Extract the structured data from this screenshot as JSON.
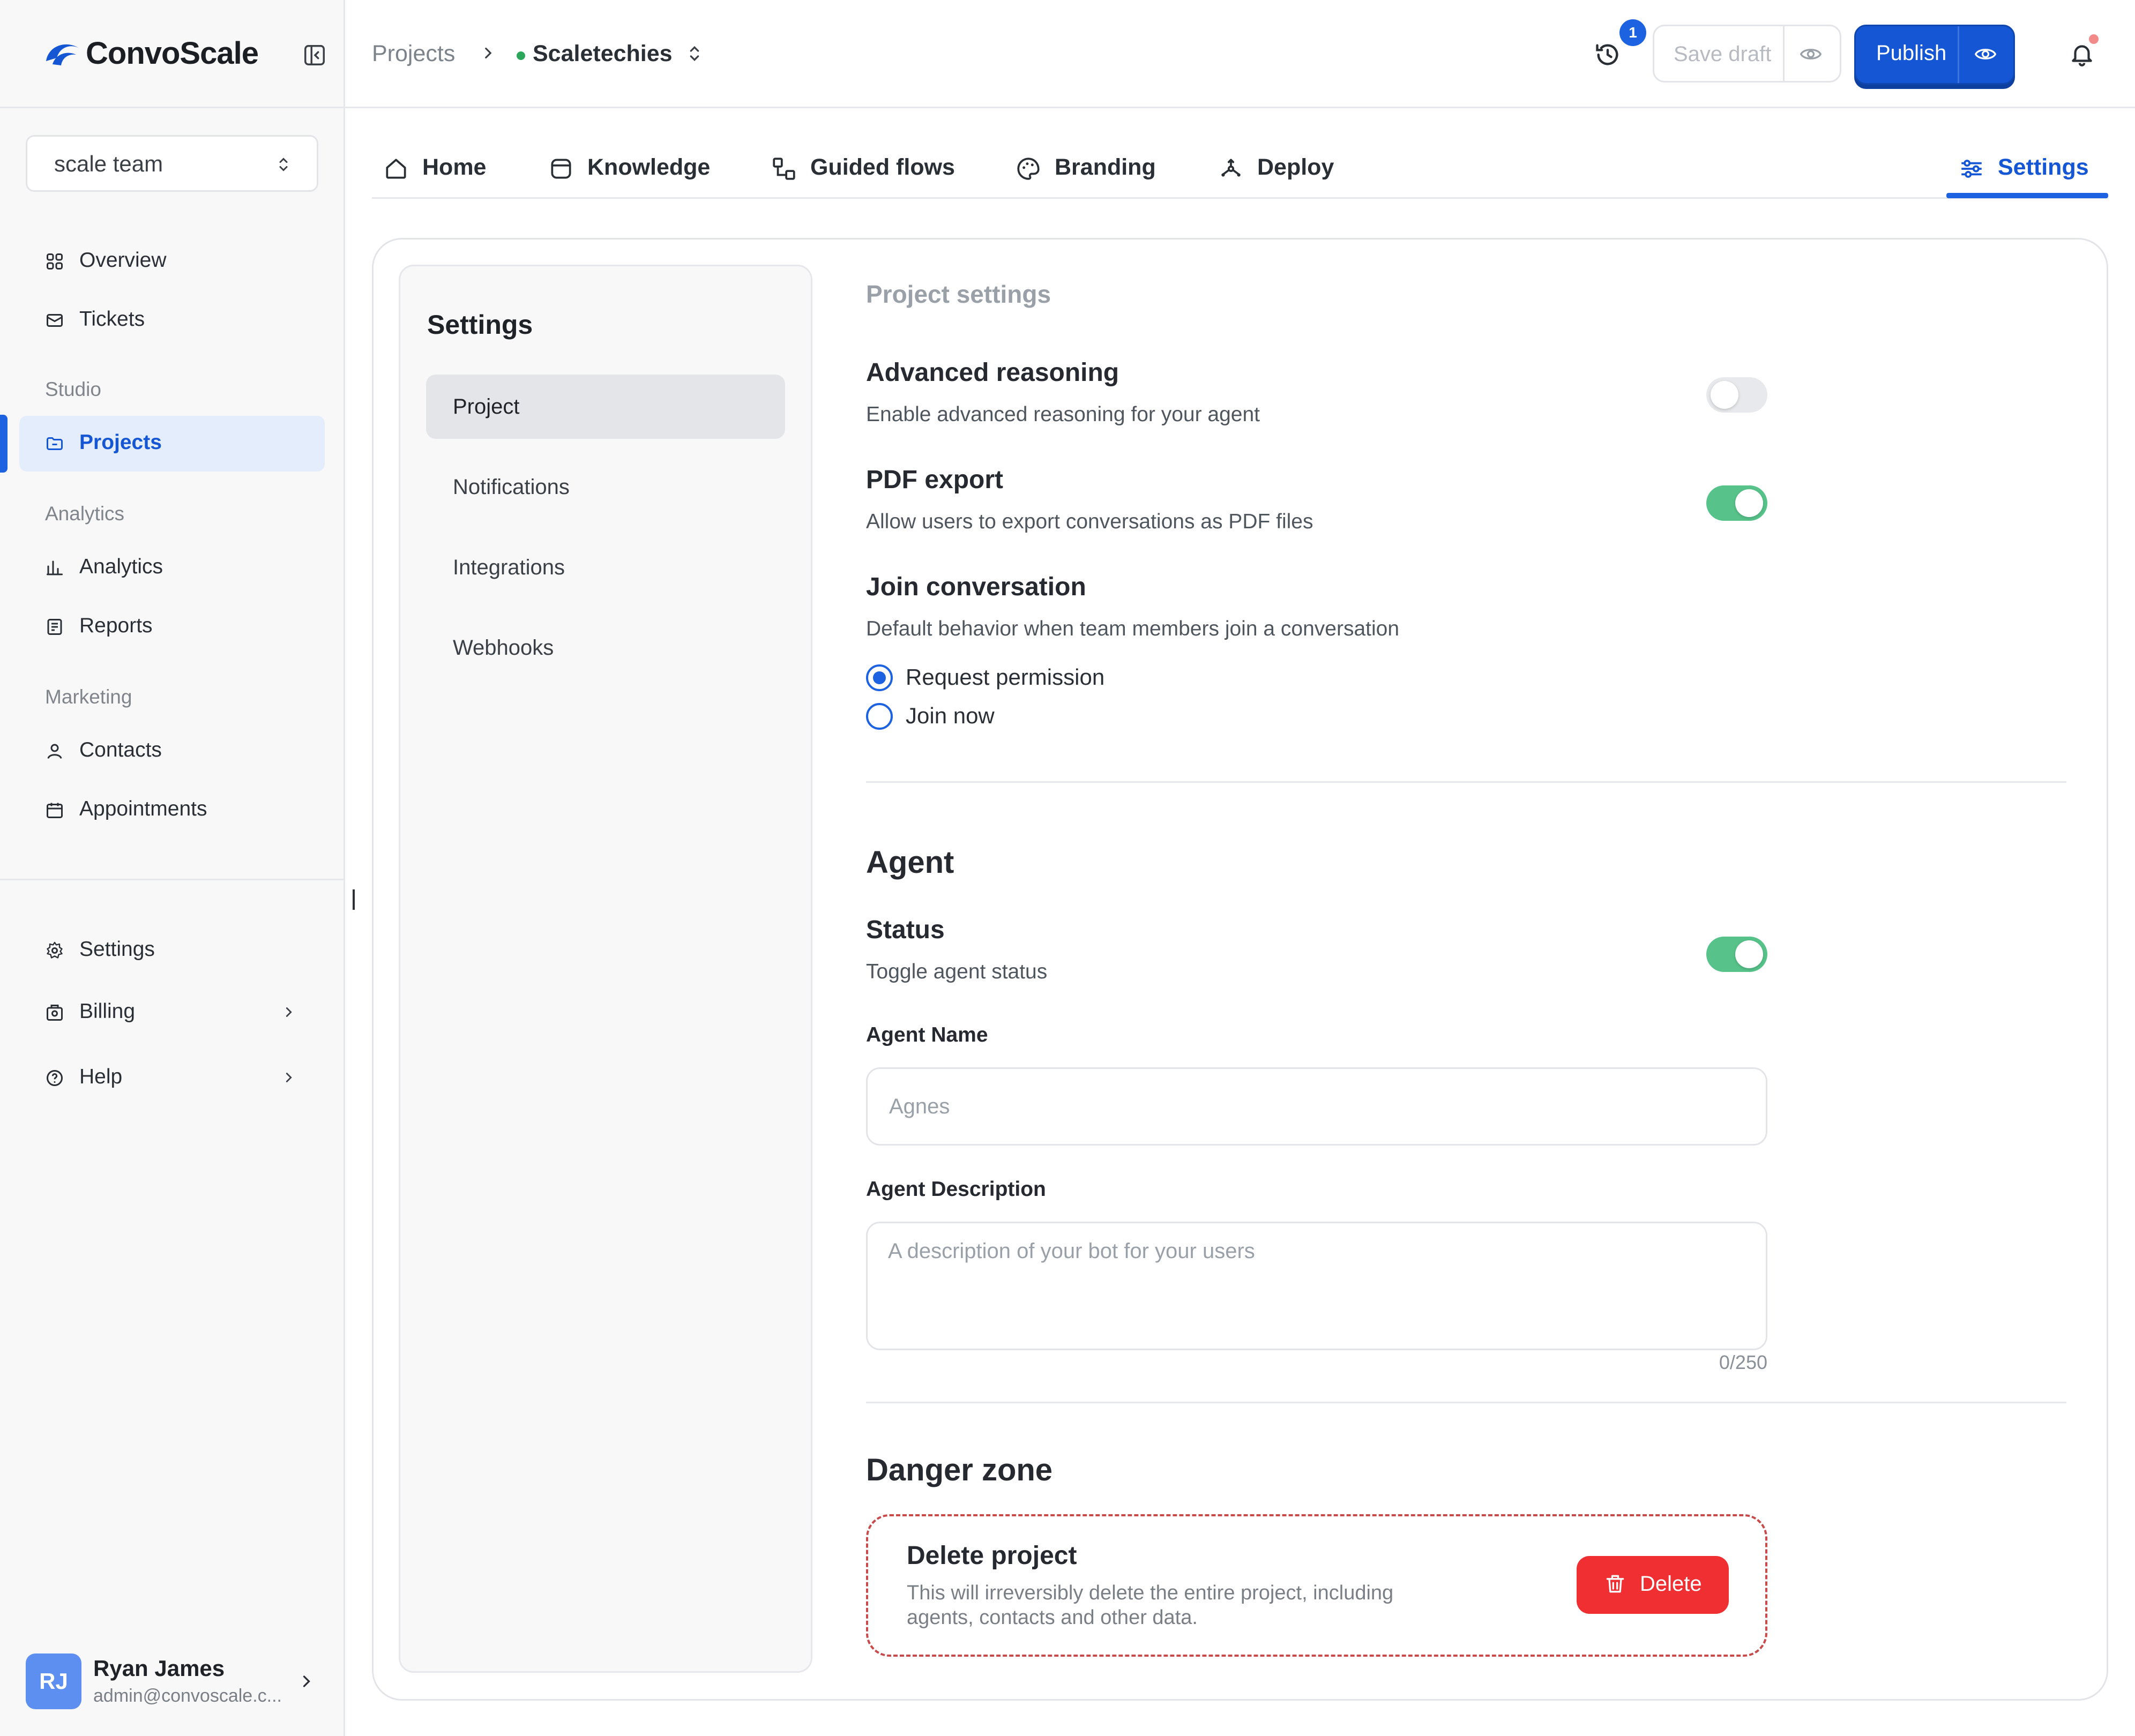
{
  "app": {
    "brand_name": "ConvoScale",
    "accent_color": "#1456d3"
  },
  "sidebar": {
    "team": "scale team",
    "items_top": [
      {
        "label": "Overview",
        "icon": "grid-icon"
      },
      {
        "label": "Tickets",
        "icon": "envelope-icon"
      }
    ],
    "groups": {
      "studio": "Studio",
      "analytics": "Analytics",
      "marketing": "Marketing"
    },
    "projects": "Projects",
    "analytics_item": "Analytics",
    "reports": "Reports",
    "contacts": "Contacts",
    "appointments": "Appointments",
    "settings": "Settings",
    "billing": "Billing",
    "help": "Help",
    "user": {
      "initials": "RJ",
      "name": "Ryan James",
      "email": "admin@convoscale.c..."
    }
  },
  "topbar": {
    "breadcrumb_root": "Projects",
    "project_name": "Scaletechies",
    "history_badge": "1",
    "save_label": "Save draft",
    "publish_label": "Publish"
  },
  "tabs": [
    {
      "label": "Home",
      "icon": "home-icon"
    },
    {
      "label": "Knowledge",
      "icon": "archive-icon"
    },
    {
      "label": "Guided flows",
      "icon": "flow-icon"
    },
    {
      "label": "Branding",
      "icon": "palette-icon"
    },
    {
      "label": "Deploy",
      "icon": "deploy-icon"
    },
    {
      "label": "Settings",
      "icon": "sliders-icon",
      "active": true
    }
  ],
  "settings_nav": {
    "title": "Settings",
    "items": [
      "Project",
      "Notifications",
      "Integrations",
      "Webhooks"
    ],
    "active": "Project"
  },
  "project_settings": {
    "section_label": "Project settings",
    "advanced_reasoning": {
      "title": "Advanced reasoning",
      "desc": "Enable advanced reasoning for your agent",
      "enabled": false
    },
    "pdf_export": {
      "title": "PDF export",
      "desc": "Allow users to export conversations as PDF files",
      "enabled": true
    },
    "join_conversation": {
      "title": "Join conversation",
      "desc": "Default behavior when team members join a conversation",
      "options": [
        "Request permission",
        "Join now"
      ],
      "selected": "Request permission"
    }
  },
  "agent": {
    "heading": "Agent",
    "status_title": "Status",
    "status_desc": "Toggle agent status",
    "status_enabled": true,
    "name_label": "Agent Name",
    "name_placeholder": "Agnes",
    "description_label": "Agent Description",
    "description_placeholder": "A description of your bot for your users",
    "description_counter": "0/250"
  },
  "danger": {
    "heading": "Danger zone",
    "title": "Delete project",
    "desc": "This will irreversibly delete the entire project, including agents, contacts and other data.",
    "button_label": "Delete",
    "color": "#ef2f32"
  }
}
